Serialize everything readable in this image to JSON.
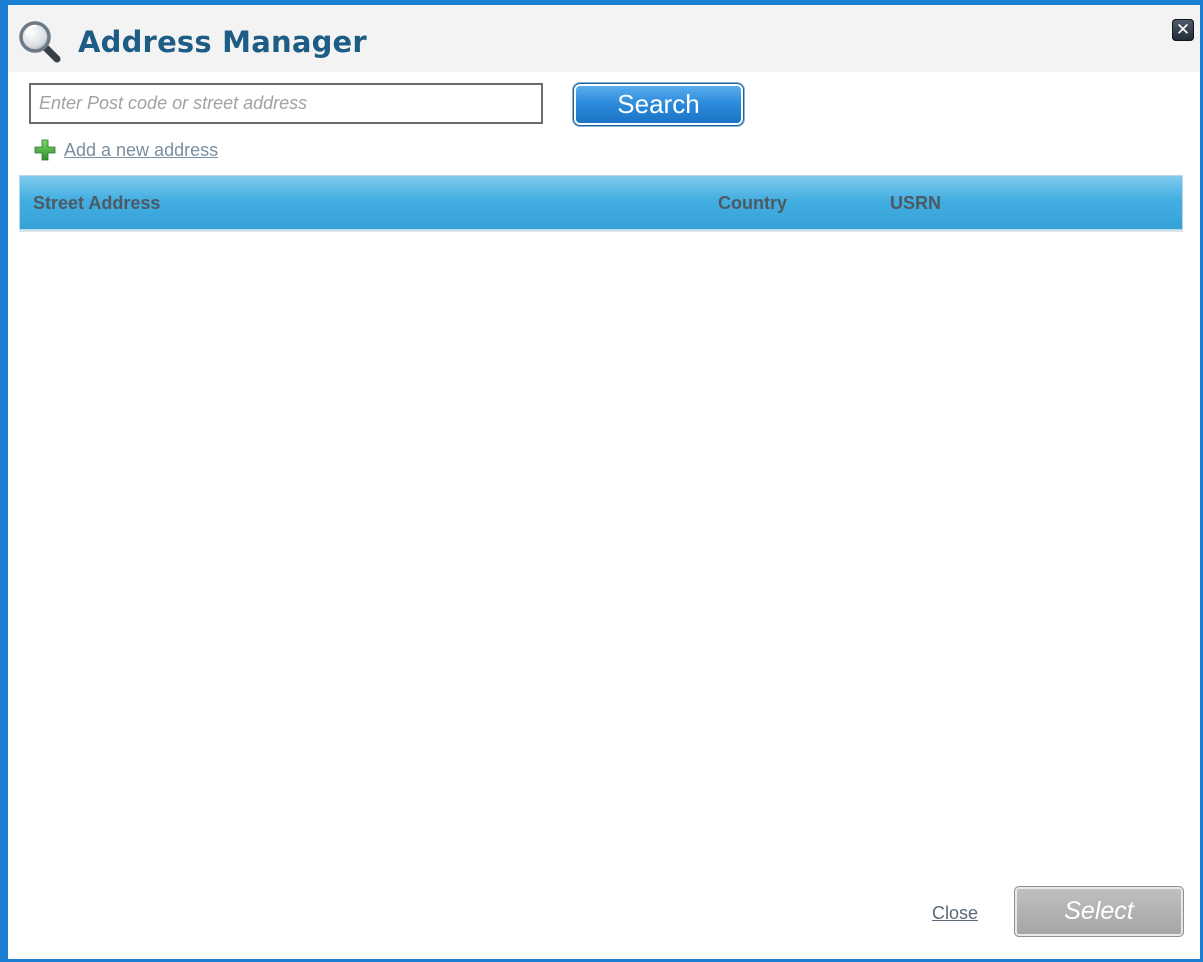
{
  "dialog": {
    "title": "Address Manager",
    "title_icon": "magnifier-icon",
    "close_icon": "close-x-icon",
    "close_glyph": "✕"
  },
  "search": {
    "placeholder": "Enter Post code or street address",
    "value": "",
    "button_label": "Search"
  },
  "add_address": {
    "icon": "plus-icon",
    "label": "Add a new address"
  },
  "table": {
    "columns": [
      "Street Address",
      "Country",
      "USRN"
    ],
    "rows": []
  },
  "footer": {
    "close_label": "Close",
    "select_label": "Select",
    "select_disabled": true
  },
  "colors": {
    "border": "#1b7fd3",
    "title": "#1d5c85",
    "search_button": "#2a89db",
    "table_header": "#43aee1",
    "plus": "#3aa83a",
    "select_disabled": "#b3b3b3"
  }
}
